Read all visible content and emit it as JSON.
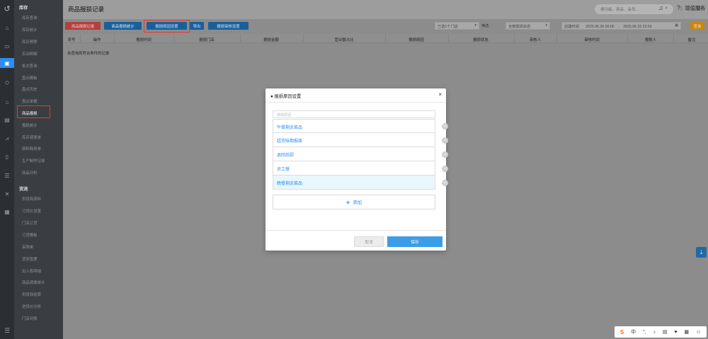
{
  "header": {
    "title": "商品报损记录",
    "search_placeholder": "搜功能、商品、会员...",
    "value_added": "增值服务"
  },
  "sidebar": {
    "sections": [
      {
        "title": "库存",
        "items": [
          "库存查询",
          "库存统计",
          "库存预警",
          "实动明细",
          "批次查询",
          "盘点模板",
          "盘点历史",
          "盘点单据",
          "商品报损",
          "报损统计",
          "库存调拨单",
          "原料耗用单",
          "生产制作记录",
          "商品分析"
        ]
      },
      {
        "title": "货流",
        "items": [
          "供货商资料",
          "订货价设置",
          "门店订货",
          "订货模板",
          "采购单",
          "货流管理",
          "出入库明细",
          "商品调拨统计",
          "供货商结算",
          "进货价分析",
          "门店对账"
        ]
      }
    ],
    "current_item": "商品报损"
  },
  "toolbar": {
    "buttons": [
      "商品报损记录",
      "商品报损统计",
      "报损原因设置",
      "导出",
      "报损审核设置"
    ],
    "store_select": "已选1个门店",
    "filter_label": "筛选",
    "status_select": "全部报损状态",
    "time_type_select": "创建时间",
    "start_time": "2025.06.26 00:00",
    "range_sep": "-",
    "end_time": "2025.06.26 23:59",
    "query_label": "查询"
  },
  "table": {
    "columns": [
      "序号",
      "操作",
      "报损时间",
      "报损门店",
      "报损金额",
      "营业额占比",
      "报损原因",
      "报损状态",
      "审核人",
      "审核时间",
      "报损人",
      "备注"
    ],
    "empty_text": "未查询到符合条件的记录"
  },
  "modal": {
    "title": "● 报损原因设置",
    "input_placeholder": "报损原因",
    "reasons": [
      "午餐剩余菜品",
      "超货味期报废",
      "退回后厨",
      "员工餐",
      "晚餐剩余菜品"
    ],
    "add_label": "添加",
    "cancel_label": "取消",
    "save_label": "保存"
  },
  "ime_tray": {
    "brand": "S",
    "lang": "中"
  },
  "colors": {
    "accent_blue": "#2d8cf0",
    "danger_red": "#e53935",
    "query_orange": "#f0a020"
  }
}
